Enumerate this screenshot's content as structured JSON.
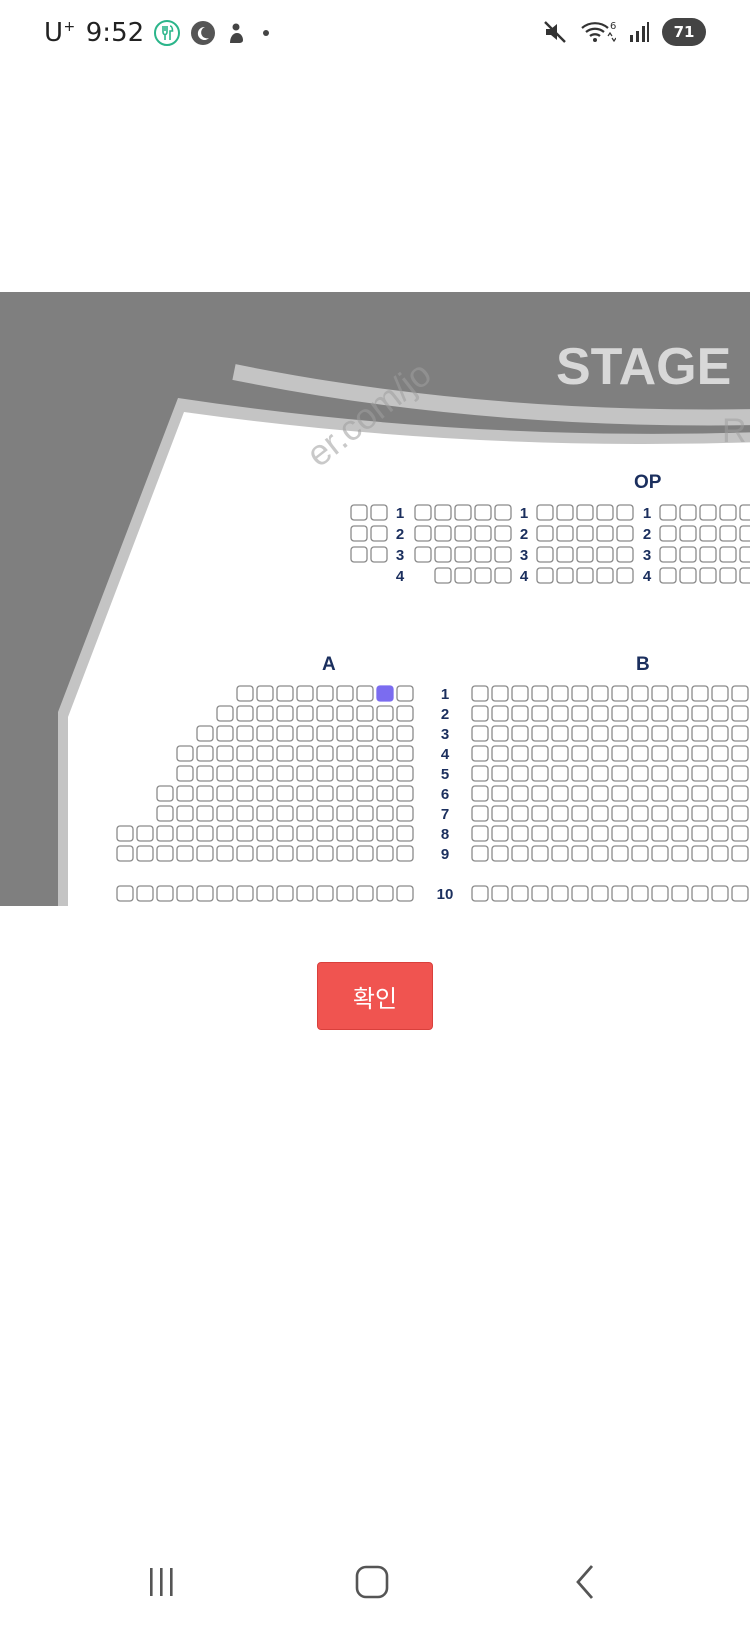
{
  "status_bar": {
    "carrier": "U",
    "carrier_sup": "+",
    "time": "9:52",
    "left_icons": [
      "fork-knife-icon",
      "moon-icon",
      "person-icon",
      "dot-icon"
    ],
    "right_icons": [
      "mute-icon",
      "wifi-icon",
      "signal-icon"
    ],
    "wifi_band": "6",
    "battery_label": "71"
  },
  "seat_map": {
    "watermark": "er.com/jo",
    "watermark_right": "R",
    "stage_label": "STAGE",
    "op_section_label": "OP",
    "op_rows": [
      "1",
      "2",
      "3",
      "4"
    ],
    "section_a_label": "A",
    "section_b_label": "B",
    "main_rows": [
      "1",
      "2",
      "3",
      "4",
      "5",
      "6",
      "7",
      "8",
      "9",
      "10"
    ],
    "selected_seat": {
      "section": "A",
      "row": "1"
    },
    "colors": {
      "background": "#7f7f7f",
      "hall_edge": "#c4c4c4",
      "hall_floor": "#ffffff",
      "seat_outline": "#8a8a8a",
      "row_label": "#1b2f5e",
      "selected_seat": "#7b6cf0"
    }
  },
  "actions": {
    "confirm_label": "확인"
  },
  "nav_bar": {
    "icons": [
      "recent-apps-icon",
      "home-icon",
      "back-icon"
    ]
  }
}
